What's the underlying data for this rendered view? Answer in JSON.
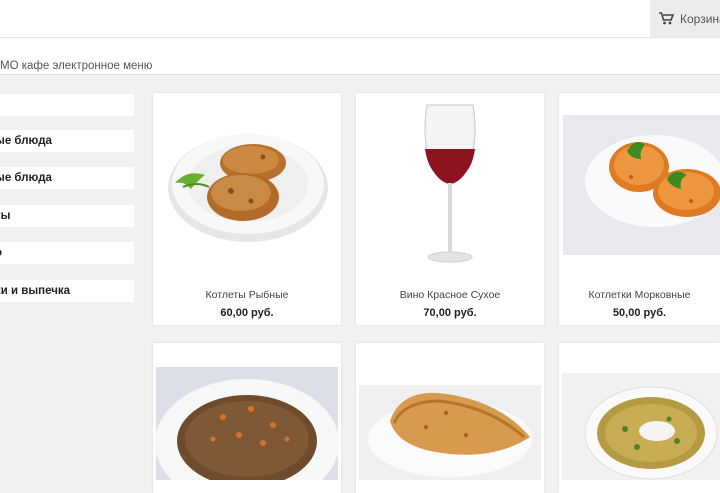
{
  "header": {
    "cart_label": "Корзина"
  },
  "breadcrumb": "МО кафе электронное меню",
  "categories": [
    {
      "label": ""
    },
    {
      "label": "ые блюда"
    },
    {
      "label": "ые блюда"
    },
    {
      "label": "ты"
    },
    {
      "label": "о"
    },
    {
      "label": "ки и выпечка"
    }
  ],
  "products": [
    {
      "name": "Котлеты Рыбные",
      "price": "60,00 руб."
    },
    {
      "name": "Вино Красное Сухое",
      "price": "70,00 руб."
    },
    {
      "name": "Котлетки Морковные",
      "price": "50,00 руб."
    },
    {
      "name": "",
      "price": ""
    },
    {
      "name": "",
      "price": ""
    },
    {
      "name": "",
      "price": ""
    }
  ]
}
